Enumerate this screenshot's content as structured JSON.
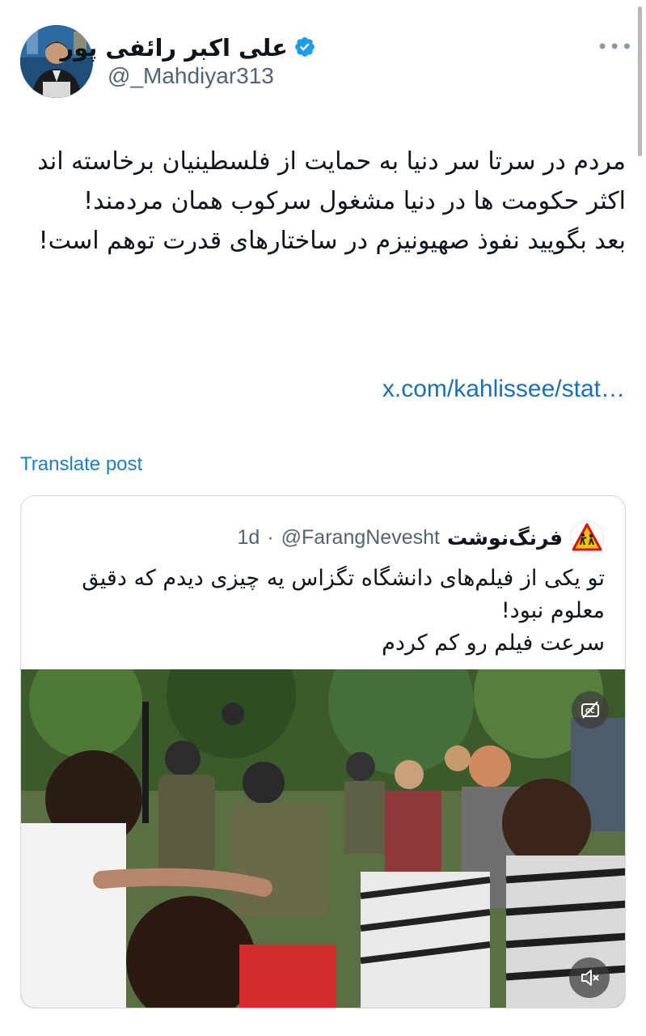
{
  "author": {
    "display_name": "علی اکبر رائفی پور",
    "handle": "@_Mahdiyar313",
    "verified": true,
    "avatar_icon": "avatar-photo"
  },
  "more_label": "•••",
  "tweet": {
    "text": "مردم در سرتا سر دنیا به حمایت از فلسطینیان برخاسته اند\nاکثر حکومت ها در دنیا مشغول سرکوب همان مردمند!\nبعد بگویید نفوذ صهیونیزم در ساختارهای قدرت توهم است!",
    "link": "x.com/kahlissee/stat…"
  },
  "translate_label": "Translate post",
  "quoted": {
    "display_name": "فرنگ‌نوشت",
    "handle": "@FarangNevesht",
    "separator": "·",
    "time": "1d",
    "avatar_icon": "warning-sign-icon",
    "text": "تو یکی از فیلم‌های دانشگاه تگزاس یه چیزی دیدم که دقیق معلوم نبود!\nسرعت فیلم رو کم کردم",
    "media": {
      "type": "video",
      "cc_icon": "captions-off-icon",
      "mute_icon": "muted-speaker-icon"
    }
  },
  "colors": {
    "link": "#1d6fb0",
    "verified": "#1d9bf0",
    "secondary_text": "#536471",
    "border": "#cfd9de"
  }
}
